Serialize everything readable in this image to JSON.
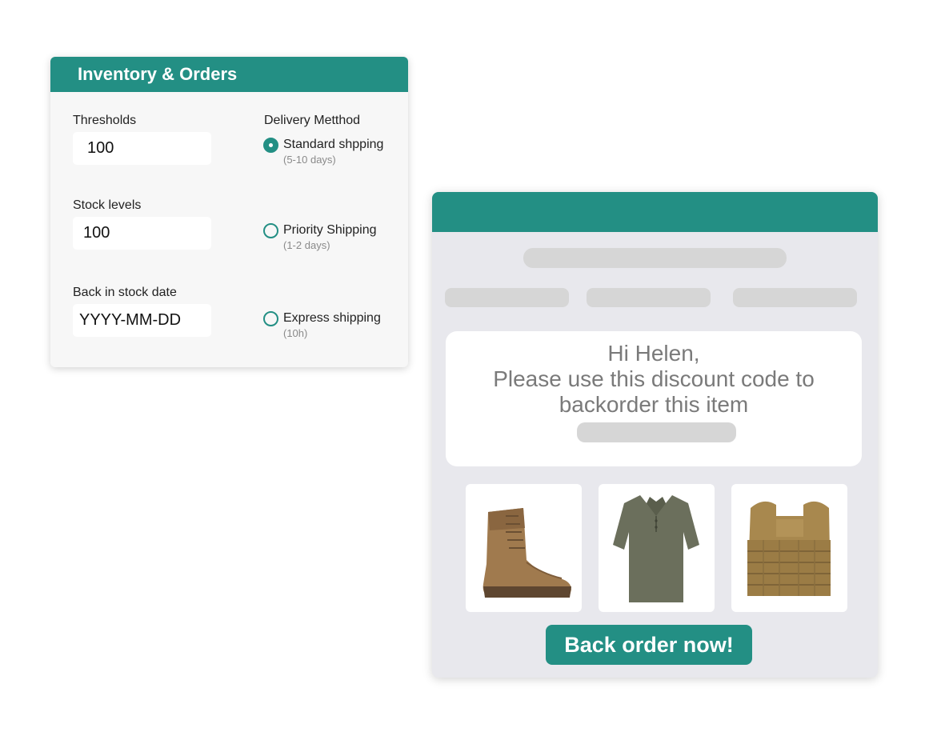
{
  "inventory": {
    "title": "Inventory & Orders",
    "thresholds": {
      "label": "Thresholds",
      "value": "100"
    },
    "stock_levels": {
      "label": "Stock levels",
      "value": "100"
    },
    "back_in_stock": {
      "label": "Back in stock date",
      "value": "YYYY-MM-DD"
    },
    "delivery": {
      "label": "Delivery Metthod",
      "options": [
        {
          "label": "Standard shpping",
          "sub": "(5-10 days)",
          "checked": true
        },
        {
          "label": "Priority Shipping",
          "sub": "(1-2 days)",
          "checked": false
        },
        {
          "label": "Express shipping",
          "sub": "(10h)",
          "checked": false
        }
      ]
    }
  },
  "email": {
    "greeting": "Hi Helen,",
    "message_line1": "Please use this discount code to",
    "message_line2": "backorder this item",
    "products": [
      "boot-image",
      "polo-shirt-image",
      "tactical-vest-image"
    ],
    "cta_label": "Back order now!"
  },
  "colors": {
    "accent": "#238f84",
    "card_bg": "#f7f7f7",
    "email_bg": "#e8e8ed",
    "skeleton": "#d6d6d6"
  }
}
